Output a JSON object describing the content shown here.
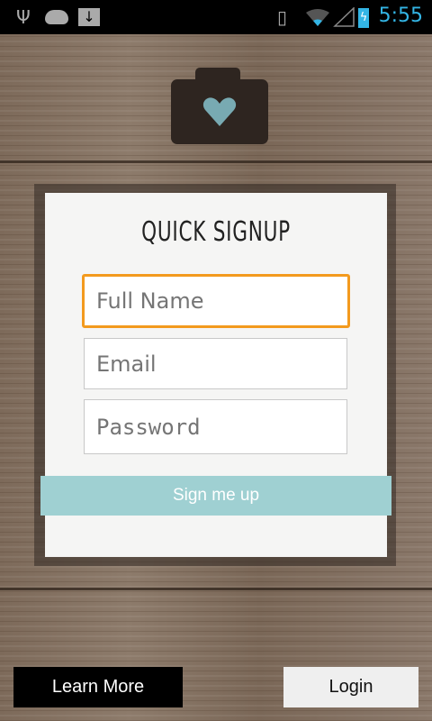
{
  "status_bar": {
    "time": "5:55",
    "left_icons": [
      "usb-icon",
      "android-icon",
      "download-icon"
    ],
    "right_icons": [
      "rotate-icon",
      "wifi-icon",
      "signal-icon",
      "battery-charging-icon"
    ],
    "accent": "#33b5e5"
  },
  "logo": {
    "icon": "camera-heart-icon",
    "heart_color": "#78aab2"
  },
  "form": {
    "title": "QUICK SIGNUP",
    "full_name_placeholder": "Full Name",
    "email_placeholder": "Email",
    "password_placeholder": "Password",
    "focus_color": "#f39a1e",
    "submit_label": "Sign me up",
    "submit_color": "#9fd0d2"
  },
  "footer": {
    "learn_more_label": "Learn More",
    "login_label": "Login"
  }
}
